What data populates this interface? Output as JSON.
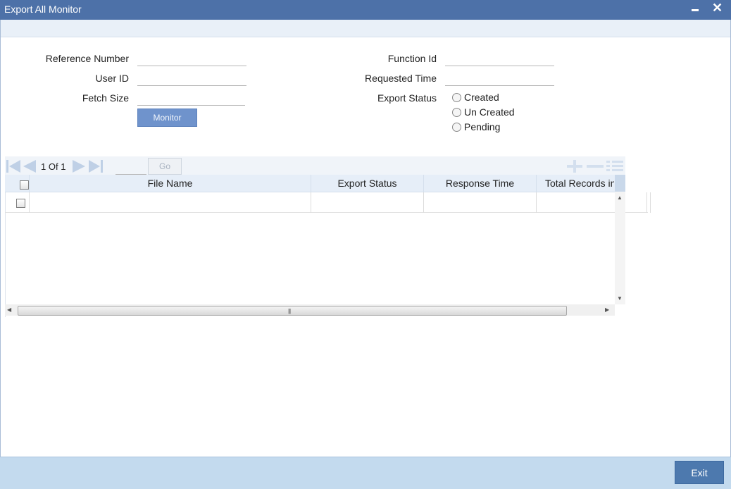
{
  "window": {
    "title": "Export All Monitor",
    "minimize_icon": "minimize-icon",
    "close_icon": "close-icon",
    "close_glyph": "✕"
  },
  "form": {
    "reference_number": {
      "label": "Reference Number",
      "value": ""
    },
    "user_id": {
      "label": "User ID",
      "value": ""
    },
    "fetch_size": {
      "label": "Fetch Size",
      "value": ""
    },
    "function_id": {
      "label": "Function Id",
      "value": ""
    },
    "requested_time": {
      "label": "Requested Time",
      "value": ""
    },
    "export_status": {
      "label": "Export Status",
      "options": [
        "Created",
        "Un Created",
        "Pending"
      ]
    },
    "monitor_button": "Monitor"
  },
  "grid": {
    "pager": {
      "current": "1",
      "of_label": "Of",
      "total": "1",
      "goto_value": ""
    },
    "go_button": "Go",
    "toolbar_icons": [
      "add-row-icon",
      "delete-row-icon",
      "columns-icon"
    ],
    "columns": [
      "File Name",
      "Export Status",
      "Response Time",
      "Total Records in"
    ],
    "rows": [
      {
        "file_name": "",
        "export_status": "",
        "response_time": "",
        "total_records": ""
      }
    ],
    "scroll_grip": "|||"
  },
  "footer": {
    "exit_button": "Exit"
  },
  "colors": {
    "titlebar": "#4d71a8",
    "footer": "#c3daee",
    "button": "#4d79ae",
    "monitor_button": "#6f93cc"
  }
}
